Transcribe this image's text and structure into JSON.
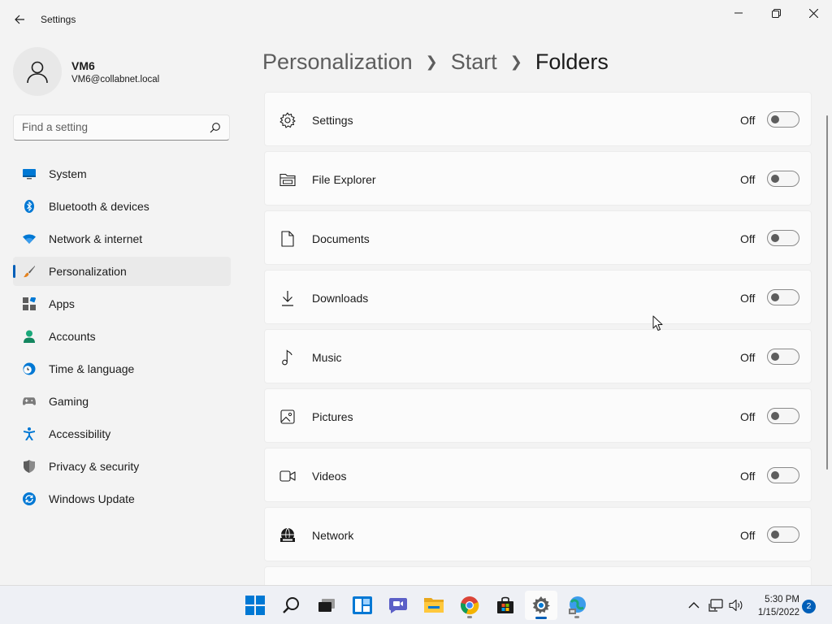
{
  "window": {
    "title": "Settings"
  },
  "user": {
    "name": "VM6",
    "email": "VM6@collabnet.local"
  },
  "search": {
    "placeholder": "Find a setting"
  },
  "sidebar": {
    "items": [
      {
        "label": "System",
        "icon": "monitor-icon"
      },
      {
        "label": "Bluetooth & devices",
        "icon": "bluetooth-icon"
      },
      {
        "label": "Network & internet",
        "icon": "wifi-icon"
      },
      {
        "label": "Personalization",
        "icon": "brush-icon",
        "active": true
      },
      {
        "label": "Apps",
        "icon": "apps-icon"
      },
      {
        "label": "Accounts",
        "icon": "person-icon"
      },
      {
        "label": "Time & language",
        "icon": "clock-globe-icon"
      },
      {
        "label": "Gaming",
        "icon": "gamepad-icon"
      },
      {
        "label": "Accessibility",
        "icon": "accessibility-icon"
      },
      {
        "label": "Privacy & security",
        "icon": "shield-icon"
      },
      {
        "label": "Windows Update",
        "icon": "update-icon"
      }
    ]
  },
  "breadcrumb": {
    "items": [
      "Personalization",
      "Start",
      "Folders"
    ]
  },
  "folders": {
    "rows": [
      {
        "label": "Settings",
        "state": "Off",
        "icon": "gear-icon"
      },
      {
        "label": "File Explorer",
        "state": "Off",
        "icon": "file-explorer-icon"
      },
      {
        "label": "Documents",
        "state": "Off",
        "icon": "document-icon"
      },
      {
        "label": "Downloads",
        "state": "Off",
        "icon": "download-icon"
      },
      {
        "label": "Music",
        "state": "Off",
        "icon": "music-icon"
      },
      {
        "label": "Pictures",
        "state": "Off",
        "icon": "picture-icon"
      },
      {
        "label": "Videos",
        "state": "Off",
        "icon": "video-icon"
      },
      {
        "label": "Network",
        "state": "Off",
        "icon": "network-icon"
      }
    ]
  },
  "taskbar": {
    "apps": [
      "start-icon",
      "search-icon",
      "task-view-icon",
      "widgets-icon",
      "chat-icon",
      "file-explorer-icon",
      "chrome-icon",
      "store-icon",
      "settings-icon",
      "network-app-icon"
    ],
    "clock": {
      "time": "5:30 PM",
      "date": "1/15/2022"
    },
    "notification_count": "2"
  },
  "colors": {
    "accent": "#005fb8",
    "background": "#f3f3f3",
    "card": "#fbfbfb"
  }
}
